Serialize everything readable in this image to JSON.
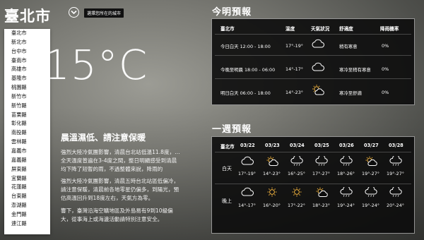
{
  "header": {
    "city": "臺北市",
    "city_hint": "選擇您所在的城市"
  },
  "current": {
    "temp": "15°C"
  },
  "warning": {
    "title": "晨溫濕低、請注意保暖",
    "paragraphs": [
      "強烈大陸冷氣團影響，清晨台北站低溫11.8度，…全天溫度普遍在3-4度之間，整日明顯感受到清晨均下降了短暫的雨，不過整體來說，降雨的",
      "強烈大陸冷氣團影響，清晨五時台北站區低偏冷，請注意保暖，清晨前各地零星仍偏多，到陽光，預估高溫回升到18度左右，天氣方為零。",
      "響下，臺灣沿海空曠地區及外島易有9到10級偏大，從事海上或海邊活動請特別注意安全。"
    ]
  },
  "city_list": [
    "臺北市",
    "新北市",
    "台中市",
    "臺南市",
    "高雄市",
    "基隆市",
    "桃園縣",
    "新竹市",
    "新竹縣",
    "苗栗縣",
    "彰化縣",
    "南投縣",
    "雲林縣",
    "嘉義市",
    "嘉義縣",
    "屏東縣",
    "宜蘭縣",
    "花蓮縣",
    "台東縣",
    "澎湖縣",
    "金門縣",
    "連江縣"
  ],
  "today": {
    "title": "今明預報",
    "headers": [
      "臺北市",
      "溫度",
      "天氣狀況",
      "舒適度",
      "降雨機率"
    ],
    "rows": [
      {
        "period": "今日白天 12:00 - 18:00",
        "temp": "17°-19°",
        "icon": "cloud-icon",
        "comfort": "稍有寒意",
        "rain": "0%"
      },
      {
        "period": "今晚至明晨 18:00 - 06:00",
        "temp": "14°-17°",
        "icon": "cloud-icon",
        "comfort": "寒冷至稍有寒意",
        "rain": "0%"
      },
      {
        "period": "明日白天 06:00 - 18:00",
        "temp": "14°-23°",
        "icon": "partly-sunny-icon",
        "comfort": "寒冷至舒適",
        "rain": "0%"
      }
    ]
  },
  "week": {
    "title": "一週預報",
    "city": "臺北市",
    "dates": [
      "03/22",
      "03/23",
      "03/24",
      "03/25",
      "03/26",
      "03/27",
      "03/28"
    ],
    "day_label": "白天",
    "night_label": "晚上",
    "day_icons": [
      "cloud-icon",
      "partly-sunny-icon",
      "cloud-rain-icon",
      "cloud-rain-icon",
      "cloud-rain-icon",
      "partly-sunny-icon",
      "cloud-rain-icon"
    ],
    "day_temps": [
      "17°-19°",
      "14°-23°",
      "16°-25°",
      "17°-27°",
      "18°-26°",
      "19°-27°",
      "19°-27°"
    ],
    "night_icons": [
      "cloud-icon",
      "sun-icon",
      "sun-icon",
      "partly-sunny-icon",
      "cloud-rain-icon",
      "cloud-rain-icon",
      "cloud-rain-icon"
    ],
    "night_temps": [
      "14°-17°",
      "16°-20°",
      "17°-22°",
      "18°-23°",
      "19°-24°",
      "19°-24°",
      "20°-24°"
    ]
  },
  "colors": {
    "sun": "#f2b33d",
    "panel": "#0c0c0c"
  }
}
